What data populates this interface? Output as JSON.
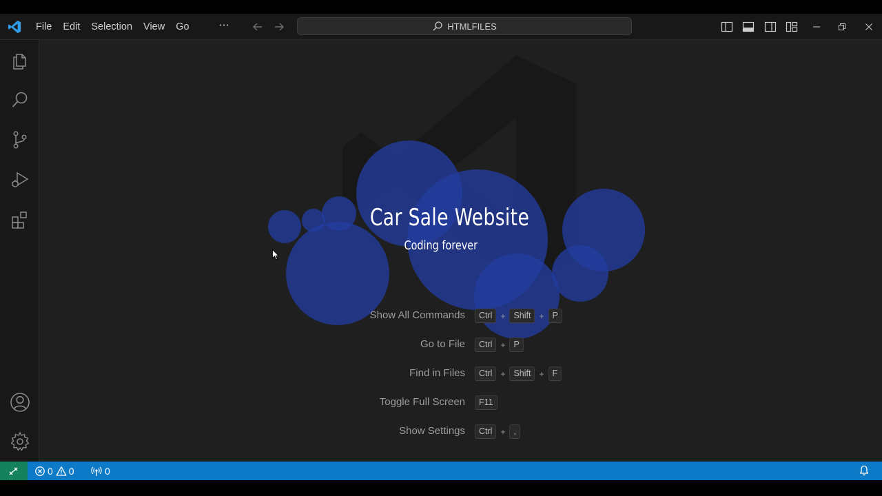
{
  "menu": {
    "items": [
      "File",
      "Edit",
      "Selection",
      "View",
      "Go"
    ],
    "more": "···"
  },
  "command_center": {
    "label": "HTMLFILES"
  },
  "hero": {
    "title": "Car Sale Website",
    "subtitle": "Coding forever"
  },
  "shortcuts": [
    {
      "label": "Show All Commands",
      "keys": [
        "Ctrl",
        "Shift",
        "P"
      ]
    },
    {
      "label": "Go to File",
      "keys": [
        "Ctrl",
        "P"
      ]
    },
    {
      "label": "Find in Files",
      "keys": [
        "Ctrl",
        "Shift",
        "F"
      ]
    },
    {
      "label": "Toggle Full Screen",
      "keys": [
        "F11"
      ]
    },
    {
      "label": "Show Settings",
      "keys": [
        "Ctrl",
        ","
      ]
    }
  ],
  "statusbar": {
    "errors": "0",
    "warnings": "0",
    "ports": "0"
  },
  "colors": {
    "statusbar": "#0c7ac7",
    "remote": "#16825d",
    "bubble": "#233c9f",
    "editor_bg": "#1f1f1f"
  },
  "icons": {
    "activity": [
      "explorer-icon",
      "search-icon",
      "source-control-icon",
      "run-debug-icon",
      "extensions-icon",
      "account-icon",
      "gear-icon"
    ]
  }
}
